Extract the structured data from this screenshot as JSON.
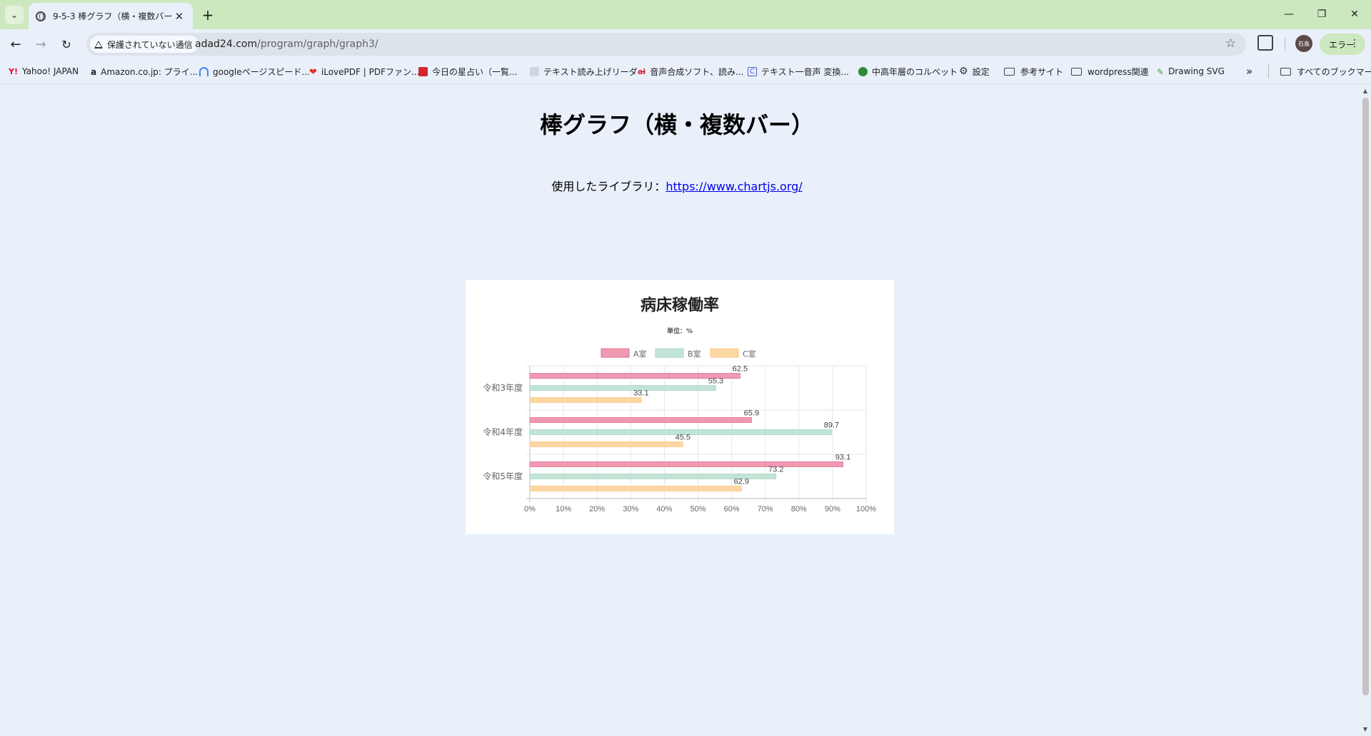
{
  "browser": {
    "tab_title": "9-5-3 棒グラフ（横・複数バー）",
    "security_label": "保護されていない通信",
    "url_host": "adad24.com",
    "url_path": "/program/graph/graph3/",
    "profile_initials": "石島",
    "error_label": "エラー"
  },
  "bookmarks": [
    {
      "label": "Yahoo! JAPAN",
      "icon": "yahoo-icon",
      "color": "#e60033"
    },
    {
      "label": "Amazon.co.jp: プライ...",
      "icon": "amazon-icon",
      "color": "#222222"
    },
    {
      "label": "googleページスピード...",
      "icon": "pagespeed-icon",
      "color": "#4285f4"
    },
    {
      "label": "iLovePDF | PDFファン...",
      "icon": "ilovepdf-icon",
      "color": "#e5322d"
    },
    {
      "label": "今日の星占い（一覧...",
      "icon": "horoscope-icon",
      "color": "#d4262c"
    },
    {
      "label": "テキスト読み上げリーダー",
      "icon": "tts-icon",
      "color": "#cfd6df"
    },
    {
      "label": "音声合成ソフト、読み...",
      "icon": "ai-voice-icon",
      "color": "#e0202f"
    },
    {
      "label": "テキスト一音声 変換...",
      "icon": "c-icon",
      "color": "#4a5fc1"
    },
    {
      "label": "中高年層のコルベット",
      "icon": "character-icon",
      "color": "#2e8b3a"
    },
    {
      "label": "設定",
      "icon": "gear-icon",
      "color": "#333333"
    },
    {
      "label": "参考サイト",
      "icon": "folder-icon",
      "color": "#444444"
    },
    {
      "label": "wordpress関連",
      "icon": "folder-icon",
      "color": "#444444"
    },
    {
      "label": "Drawing SVG",
      "icon": "svg-icon",
      "color": "#4a9a3a"
    }
  ],
  "bookmarks_all": "すべてのブックマーク",
  "page": {
    "title": "棒グラフ（横・複数バー）",
    "library_prefix": "使用したライブラリ：",
    "library_link": "https://www.chartjs.org/"
  },
  "chart_data": {
    "type": "bar",
    "orientation": "horizontal",
    "title": "病床稼働率",
    "subtitle": "単位：%",
    "categories": [
      "令和3年度",
      "令和4年度",
      "令和5年度"
    ],
    "series": [
      {
        "name": "A室",
        "values": [
          62.5,
          65.9,
          93.1
        ],
        "color": "#ef9ab1",
        "border": "#e07090"
      },
      {
        "name": "B室",
        "values": [
          55.3,
          89.7,
          73.2
        ],
        "color": "#c2e4d6",
        "border": "#a8d6c2"
      },
      {
        "name": "C室",
        "values": [
          33.1,
          45.5,
          62.9
        ],
        "color": "#fdd7a3",
        "border": "#f8c886"
      }
    ],
    "xlim": [
      0,
      100
    ],
    "x_ticks": [
      "0%",
      "10%",
      "20%",
      "30%",
      "40%",
      "50%",
      "60%",
      "70%",
      "80%",
      "90%",
      "100%"
    ],
    "grid": true,
    "legend_position": "top"
  }
}
